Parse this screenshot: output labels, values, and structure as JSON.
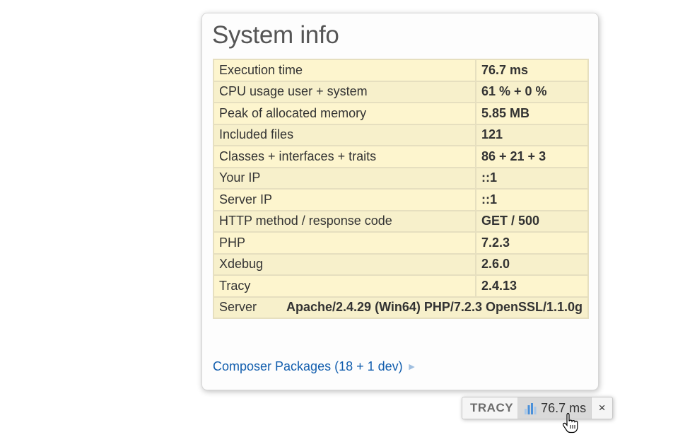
{
  "panel": {
    "title": "System info",
    "rows": [
      {
        "label": "Execution time",
        "value": "76.7 ms"
      },
      {
        "label": "CPU usage user + system",
        "value": "61 % + 0 %"
      },
      {
        "label": "Peak of allocated memory",
        "value": "5.85 MB"
      },
      {
        "label": "Included files",
        "value": "121"
      },
      {
        "label": "Classes + interfaces + traits",
        "value": "86 + 21 + 3"
      },
      {
        "label": "Your IP",
        "value": "::1"
      },
      {
        "label": "Server IP",
        "value": "::1"
      },
      {
        "label": "HTTP method / response code",
        "value": "GET / 500"
      },
      {
        "label": "PHP",
        "value": "7.2.3"
      },
      {
        "label": "Xdebug",
        "value": "2.6.0"
      },
      {
        "label": "Tracy",
        "value": "2.4.13"
      }
    ],
    "server": {
      "label": "Server",
      "value": "Apache/2.4.29 (Win64) PHP/7.2.3 OpenSSL/1.1.0g"
    },
    "composer_link": "Composer Packages (18 + 1 dev)",
    "composer_arrow": "►"
  },
  "tracy_bar": {
    "logo": "TRACY",
    "time_label": "76.7 ms",
    "close_glyph": "×",
    "icon_name": "bar-chart-icon",
    "accent": "#4a90d9"
  },
  "colors": {
    "row_background": "#fdf5ce",
    "row_border": "#e6dfbf",
    "link": "#125eae",
    "title": "#555555"
  }
}
